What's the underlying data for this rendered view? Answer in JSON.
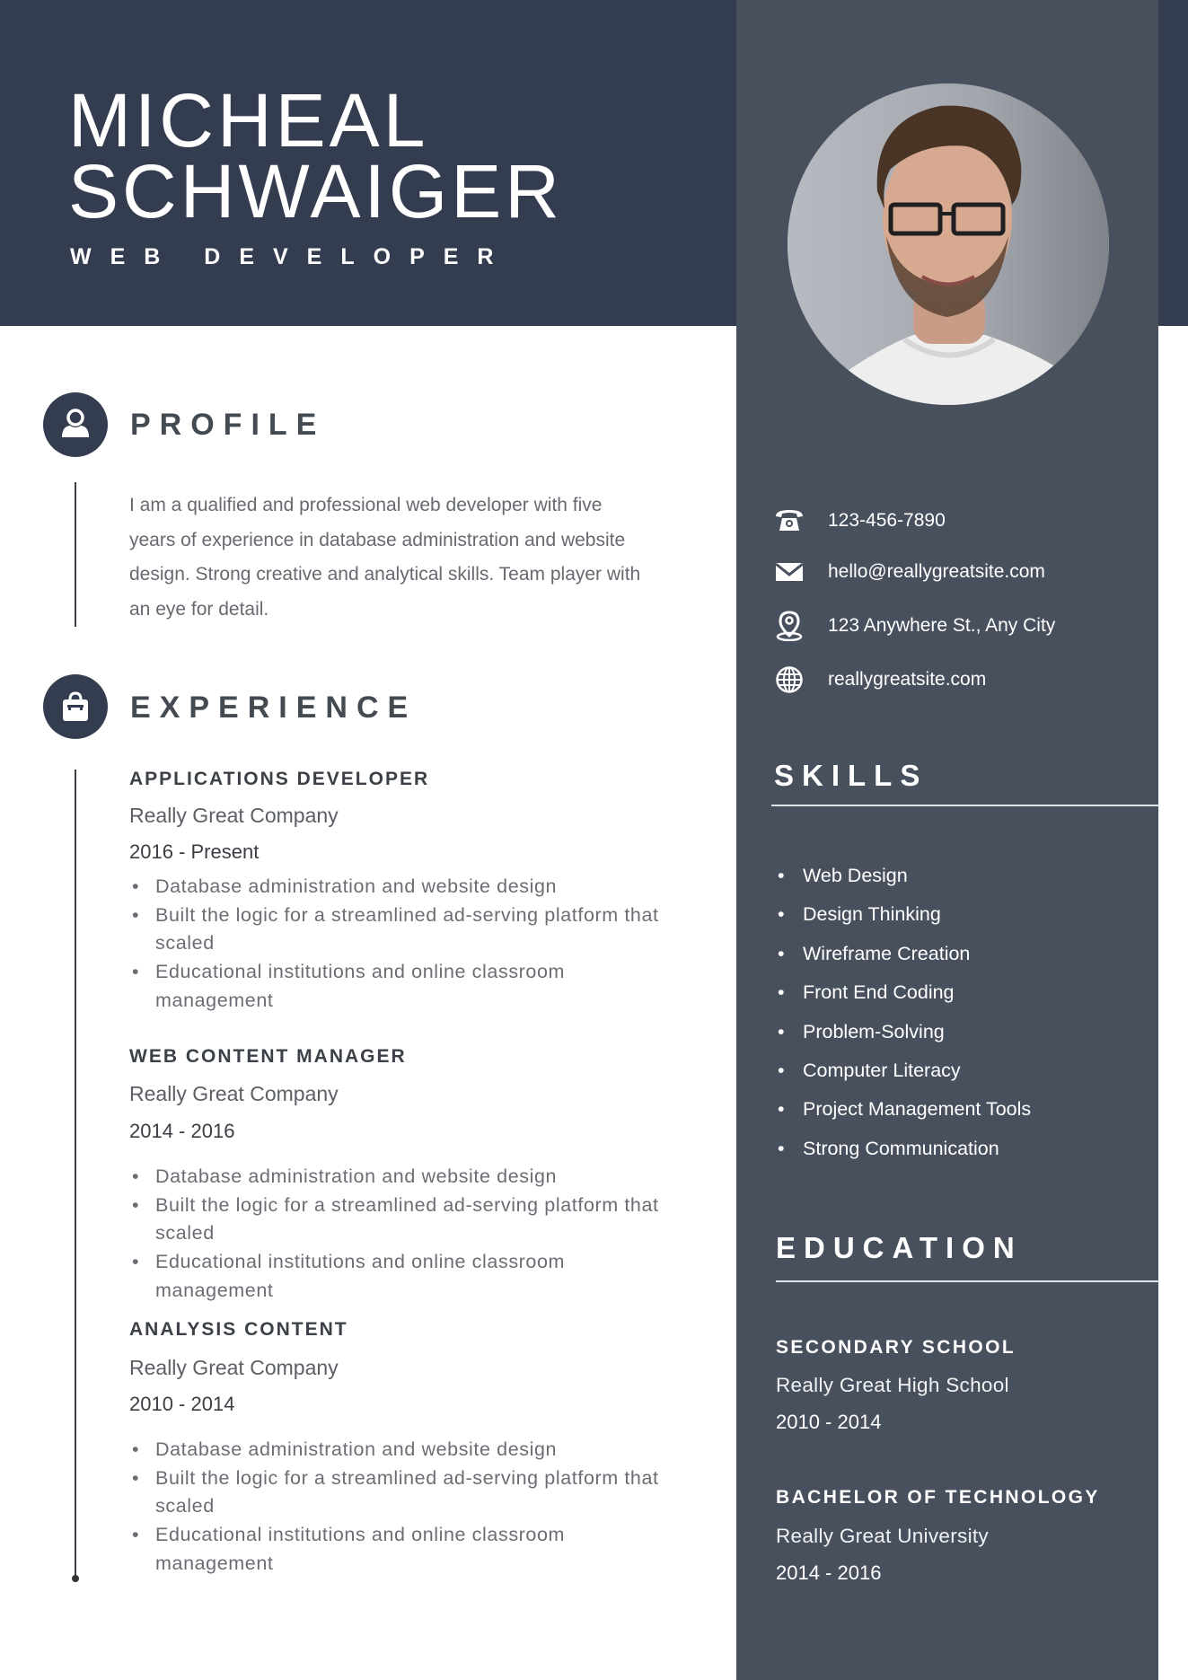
{
  "header": {
    "first_name": "MICHEAL",
    "last_name": "SCHWAIGER",
    "title": "WEB DEVELOPER",
    "photo_alt": "Portrait photo"
  },
  "colors": {
    "header_bg": "#343c4f",
    "sidebar_bg": "#484f5d",
    "heading_text": "#444a52",
    "body_text": "#666a70"
  },
  "profile": {
    "heading": "PROFILE",
    "icon": "user-icon",
    "text": "I am a qualified and professional web developer with five years of experience in database administration and website design. Strong creative and analytical skills. Team player with an eye for detail."
  },
  "experience": {
    "heading": "EXPERIENCE",
    "icon": "briefcase-icon",
    "jobs": [
      {
        "title": "APPLICATIONS DEVELOPER",
        "company": "Really Great Company",
        "dates": "2016 - Present",
        "bullets": [
          "Database administration and website design",
          "Built the logic for a streamlined ad-serving platform that scaled",
          "Educational institutions and online classroom management"
        ]
      },
      {
        "title": "WEB CONTENT MANAGER",
        "company": "Really Great Company",
        "dates": "2014 - 2016",
        "bullets": [
          "Database administration and website design",
          "Built the logic for a streamlined ad-serving platform that scaled",
          "Educational institutions and online classroom management"
        ]
      },
      {
        "title": "ANALYSIS CONTENT",
        "company": "Really Great Company",
        "dates": "2010 - 2014",
        "bullets": [
          "Database administration and website design",
          "Built the logic for a streamlined ad-serving platform that scaled",
          "Educational institutions and online classroom management"
        ]
      }
    ]
  },
  "contact": {
    "phone": {
      "icon": "phone-icon",
      "value": "123-456-7890"
    },
    "email": {
      "icon": "mail-icon",
      "value": "hello@reallygreatsite.com"
    },
    "address": {
      "icon": "location-pin-icon",
      "value": "123 Anywhere St., Any City"
    },
    "website": {
      "icon": "globe-icon",
      "value": "reallygreatsite.com"
    }
  },
  "skills": {
    "heading": "SKILLS",
    "items": [
      "Web Design",
      "Design Thinking",
      "Wireframe Creation",
      "Front End Coding",
      "Problem-Solving",
      "Computer Literacy",
      "Project Management Tools",
      "Strong Communication"
    ]
  },
  "education": {
    "heading": "EDUCATION",
    "entries": [
      {
        "degree": "SECONDARY SCHOOL",
        "school": "Really Great High School",
        "years": "2010 - 2014"
      },
      {
        "degree": "BACHELOR OF TECHNOLOGY",
        "school": "Really Great University",
        "years": "2014 - 2016"
      }
    ]
  }
}
